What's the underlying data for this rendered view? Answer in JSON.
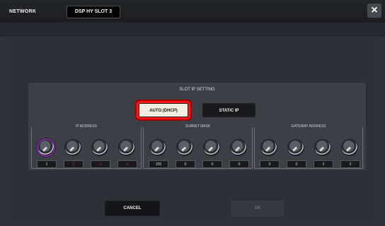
{
  "titlebar": {
    "app_title": "NETWORK",
    "slot_tab": "DSP HY SLOT 3",
    "close_label": "×"
  },
  "panel": {
    "title": "SLOT IP SETTING",
    "buttons": {
      "auto": "AUTO (DHCP)",
      "static": "STATIC IP"
    },
    "groups": [
      {
        "label": "IP ADDRESS",
        "values": [
          "1",
          "0",
          "0",
          "0"
        ]
      },
      {
        "label": "SUBNET MASK",
        "values": [
          "255",
          "0",
          "0",
          "0"
        ]
      },
      {
        "label": "GATEWAY ADDRESS",
        "values": [
          "0",
          "0",
          "0",
          "0"
        ]
      }
    ]
  },
  "footer": {
    "cancel": "CANCEL",
    "ok": "OK"
  },
  "colors": {
    "highlight": "#ff1717",
    "active_knob": "#7e2d9b",
    "invalid_value": "#c51f2d"
  }
}
